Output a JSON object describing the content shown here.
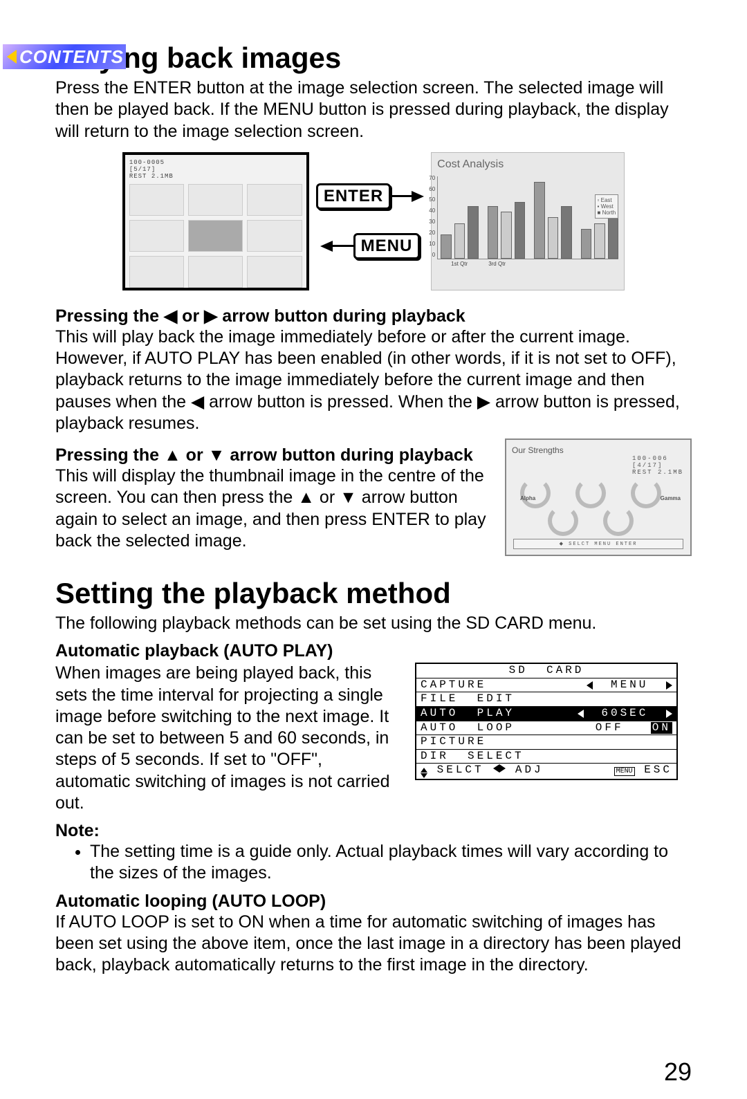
{
  "contents_label": "CONTENTS",
  "h1a": "Playing back images",
  "p1": "Press the ENTER button at the image selection screen. The selected image will then be played back. If the MENU button is pressed during playback, the display will return to the image selection screen.",
  "thumb_info": {
    "file": "100-0005",
    "index": "[5/17]",
    "rest": "REST 2.1MB"
  },
  "key_enter": "ENTER",
  "key_menu": "MENU",
  "chart_data": {
    "type": "bar",
    "title": "Cost Analysis",
    "categories": [
      "1st Qtr",
      "3rd Qtr"
    ],
    "series": [
      {
        "name": "East",
        "values": [
          20,
          45,
          65,
          25
        ]
      },
      {
        "name": "West",
        "values": [
          30,
          40,
          35,
          30
        ]
      },
      {
        "name": "North",
        "values": [
          45,
          48,
          45,
          45
        ]
      }
    ],
    "ylim": [
      0,
      70
    ],
    "yticks": [
      0,
      10,
      20,
      30,
      40,
      50,
      60,
      70
    ]
  },
  "sub1_title": "Pressing the ◀ or ▶ arrow button during playback",
  "sub1_body": "This will play back the image immediately before or after the current image. However, if AUTO PLAY has been enabled (in other words, if it is not set to OFF), playback returns to the image immediately before the current image and then pauses when the ◀ arrow button is pressed. When the ▶ arrow button is pressed, playback resumes.",
  "sub2_title": "Pressing the ▲ or ▼ arrow button during playback",
  "sub2_body": "This will display the thumbnail image in the centre of the screen. You can then press the ▲ or ▼ arrow button again to select an image, and then press ENTER to play back the selected image.",
  "strengths": {
    "title": "Our Strengths",
    "file": "100-006",
    "index": "[4/17]",
    "rest": "REST 2.1MB",
    "labels": {
      "alpha": "Alpha",
      "gamma": "Gamma"
    },
    "footer": "◆ SELCT  MENU ENTER"
  },
  "h1b": "Setting the playback method",
  "p2": "The following playback methods can be set using the SD CARD menu.",
  "sub3_title": "Automatic playback (AUTO PLAY)",
  "sub3_body": "When images are being played back, this sets the time interval for projecting a single image before switching to the next image. It can be set to between 5 and 60 seconds, in steps of 5 seconds. If set to \"OFF\", automatic switching of images is not carried out.",
  "sd_menu": {
    "title": "SD  CARD",
    "rows": {
      "capture": {
        "label": "CAPTURE",
        "value": "MENU"
      },
      "file_edit": {
        "label": "FILE  EDIT"
      },
      "auto_play": {
        "label": "AUTO  PLAY",
        "value": "60SEC"
      },
      "auto_loop": {
        "label": "AUTO  LOOP",
        "value_off": "OFF",
        "value_on": "ON"
      },
      "picture": {
        "label": "PICTURE"
      },
      "dir_select": {
        "label": "DIR  SELECT"
      },
      "footer": {
        "selct": "SELCT",
        "adj": "ADJ",
        "menu": "MENU",
        "esc": "ESC"
      }
    }
  },
  "note_label": "Note:",
  "note_item": "The setting time is a guide only. Actual playback times will vary according to the sizes of the images.",
  "sub4_title": "Automatic looping (AUTO LOOP)",
  "sub4_body": "If AUTO LOOP is set to ON when a time for automatic switching of images has been set using the above item, once the last image in a directory has been played back, playback automatically returns to the first image in the directory.",
  "page_number": "29"
}
